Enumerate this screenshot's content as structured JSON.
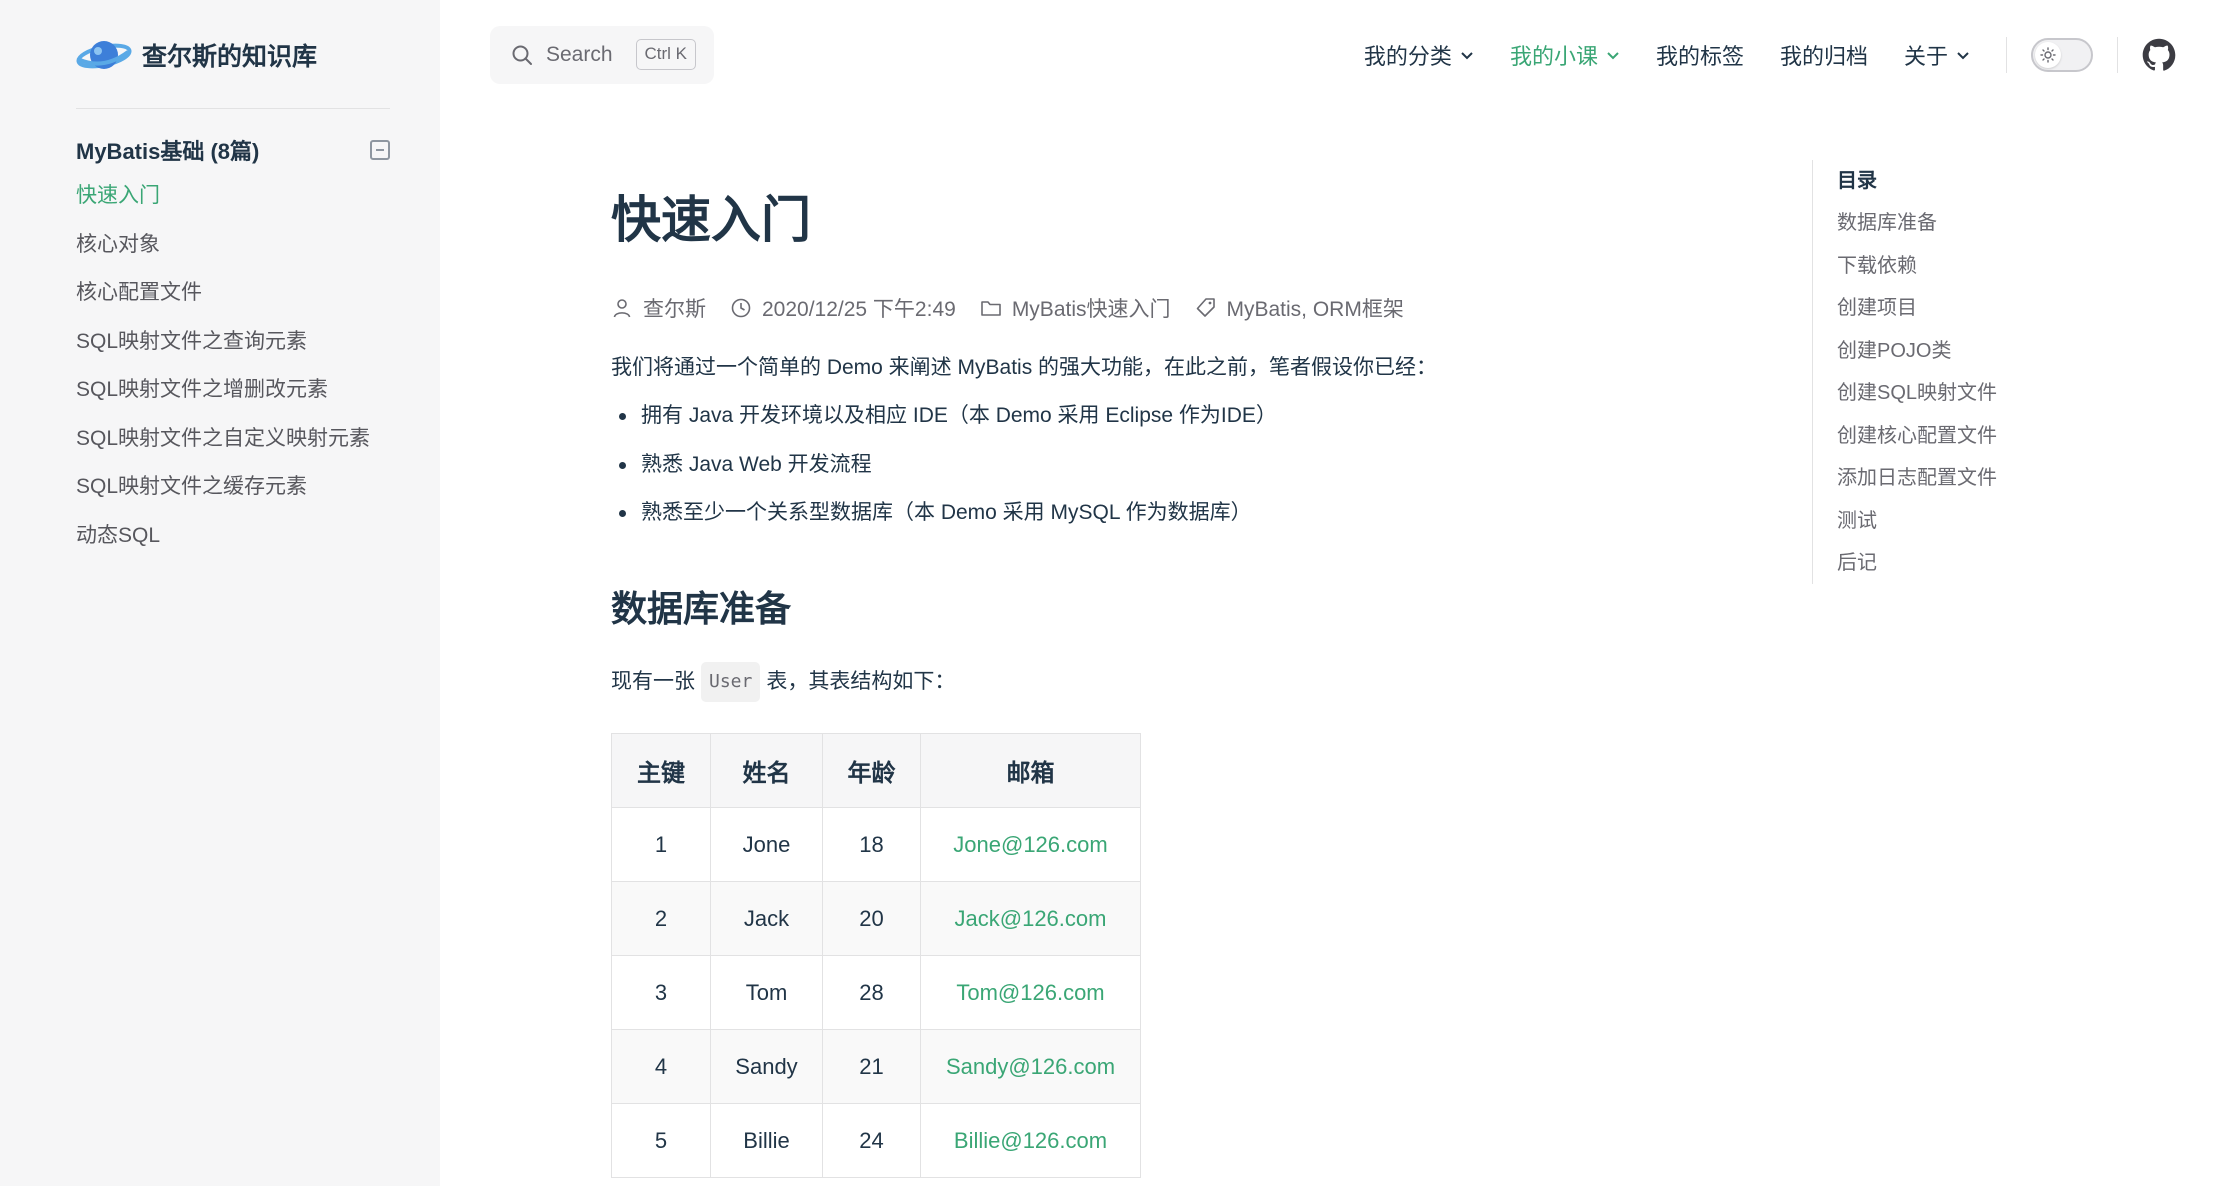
{
  "brand": {
    "title": "查尔斯的知识库",
    "logo": "planet-logo"
  },
  "sidebar": {
    "group_title": "MyBatis基础 (8篇)",
    "items": [
      {
        "label": "快速入门",
        "active": true
      },
      {
        "label": "核心对象"
      },
      {
        "label": "核心配置文件"
      },
      {
        "label": "SQL映射文件之查询元素"
      },
      {
        "label": "SQL映射文件之增删改元素"
      },
      {
        "label": "SQL映射文件之自定义映射元素"
      },
      {
        "label": "SQL映射文件之缓存元素"
      },
      {
        "label": "动态SQL"
      }
    ]
  },
  "search": {
    "label": "Search",
    "shortcut": "Ctrl K"
  },
  "nav": {
    "items": [
      {
        "label": "我的分类",
        "dropdown": true
      },
      {
        "label": "我的小课",
        "dropdown": true,
        "active": true
      },
      {
        "label": "我的标签"
      },
      {
        "label": "我的归档"
      },
      {
        "label": "关于",
        "dropdown": true
      }
    ]
  },
  "article": {
    "title": "快速入门",
    "meta": {
      "author": "查尔斯",
      "date": "2020/12/25 下午2:49",
      "category": "MyBatis快速入门",
      "tags": "MyBatis, ORM框架"
    },
    "intro": "我们将通过一个简单的 Demo 来阐述 MyBatis 的强大功能，在此之前，笔者假设你已经：",
    "bullets": [
      "拥有 Java 开发环境以及相应 IDE（本 Demo 采用 Eclipse 作为IDE）",
      "熟悉 Java Web 开发流程",
      "熟悉至少一个关系型数据库（本 Demo 采用 MySQL 作为数据库）"
    ],
    "section_heading": "数据库准备",
    "para_before": "现有一张",
    "para_code": "User",
    "para_after": "表，其表结构如下：",
    "table": {
      "headers": [
        "主键",
        "姓名",
        "年龄",
        "邮箱"
      ],
      "rows": [
        [
          "1",
          "Jone",
          "18",
          "Jone@126.com"
        ],
        [
          "2",
          "Jack",
          "20",
          "Jack@126.com"
        ],
        [
          "3",
          "Tom",
          "28",
          "Tom@126.com"
        ],
        [
          "4",
          "Sandy",
          "21",
          "Sandy@126.com"
        ],
        [
          "5",
          "Billie",
          "24",
          "Billie@126.com"
        ]
      ]
    }
  },
  "toc": {
    "title": "目录",
    "items": [
      "数据库准备",
      "下载依赖",
      "创建项目",
      "创建POJO类",
      "创建SQL映射文件",
      "创建核心配置文件",
      "添加日志配置文件",
      "测试",
      "后记"
    ]
  },
  "colors": {
    "accent": "#3aa675",
    "text": "#213547",
    "muted": "#6a6a71",
    "sidebar_bg": "#f6f6f7"
  }
}
